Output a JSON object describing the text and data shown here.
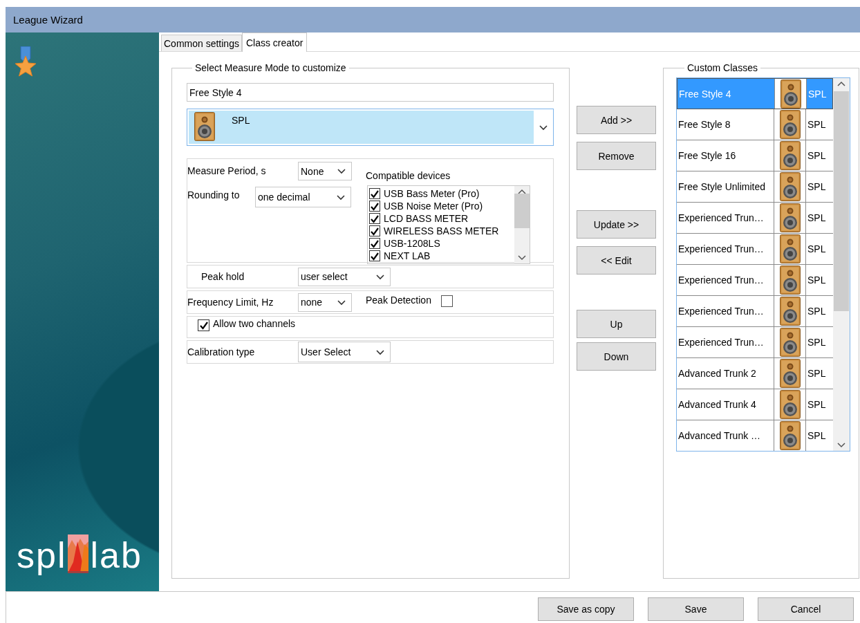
{
  "window": {
    "title": "League Wizard"
  },
  "logo": {
    "left": "spl",
    "right": "lab"
  },
  "tabs": [
    {
      "label": "Common settings",
      "selected": false
    },
    {
      "label": "Class creator",
      "selected": true
    }
  ],
  "measure_mode": {
    "legend": "Select Measure Mode to customize",
    "name": "Free Style 4",
    "mode": "SPL",
    "measure_period": {
      "label": "Measure Period, s",
      "value": "None"
    },
    "rounding": {
      "label": "Rounding to",
      "value": "one decimal"
    },
    "compatible_devices": {
      "label": "Compatible devices",
      "items": [
        {
          "label": "USB Bass Meter (Pro)",
          "checked": true
        },
        {
          "label": "USB Noise Meter (Pro)",
          "checked": true
        },
        {
          "label": "LCD BASS METER",
          "checked": true
        },
        {
          "label": "WIRELESS BASS METER",
          "checked": true
        },
        {
          "label": "USB-1208LS",
          "checked": true
        },
        {
          "label": "NEXT LAB",
          "checked": true
        }
      ]
    },
    "peak_hold": {
      "label": "Peak hold",
      "value": "user select"
    },
    "frequency_limit": {
      "label": "Frequency Limit, Hz",
      "value": "none"
    },
    "peak_detection": {
      "label": "Peak Detection",
      "checked": false
    },
    "allow_two_channels": {
      "label": "Allow two channels",
      "checked": true
    },
    "calibration_type": {
      "label": "Calibration type",
      "value": "User Select"
    }
  },
  "actions": [
    "Add >>",
    "Remove",
    "Update >>",
    "<< Edit",
    "Up",
    "Down"
  ],
  "custom_classes": {
    "legend": "Custom Classes",
    "rows": [
      {
        "name": "Free Style 4",
        "type": "SPL",
        "selected": true
      },
      {
        "name": "Free Style 8",
        "type": "SPL",
        "selected": false
      },
      {
        "name": "Free Style 16",
        "type": "SPL",
        "selected": false
      },
      {
        "name": "Free Style Unlimited",
        "type": "SPL",
        "selected": false
      },
      {
        "name": "Experienced Trun…",
        "type": "SPL",
        "selected": false
      },
      {
        "name": "Experienced Trun…",
        "type": "SPL",
        "selected": false
      },
      {
        "name": "Experienced Trun…",
        "type": "SPL",
        "selected": false
      },
      {
        "name": "Experienced Trun…",
        "type": "SPL",
        "selected": false
      },
      {
        "name": "Experienced Trun…",
        "type": "SPL",
        "selected": false
      },
      {
        "name": "Advanced Trunk 2",
        "type": "SPL",
        "selected": false
      },
      {
        "name": "Advanced Trunk 4",
        "type": "SPL",
        "selected": false
      },
      {
        "name": "Advanced Trunk …",
        "type": "SPL",
        "selected": false
      }
    ]
  },
  "footer_buttons": [
    "Save as copy",
    "Save",
    "Cancel"
  ]
}
